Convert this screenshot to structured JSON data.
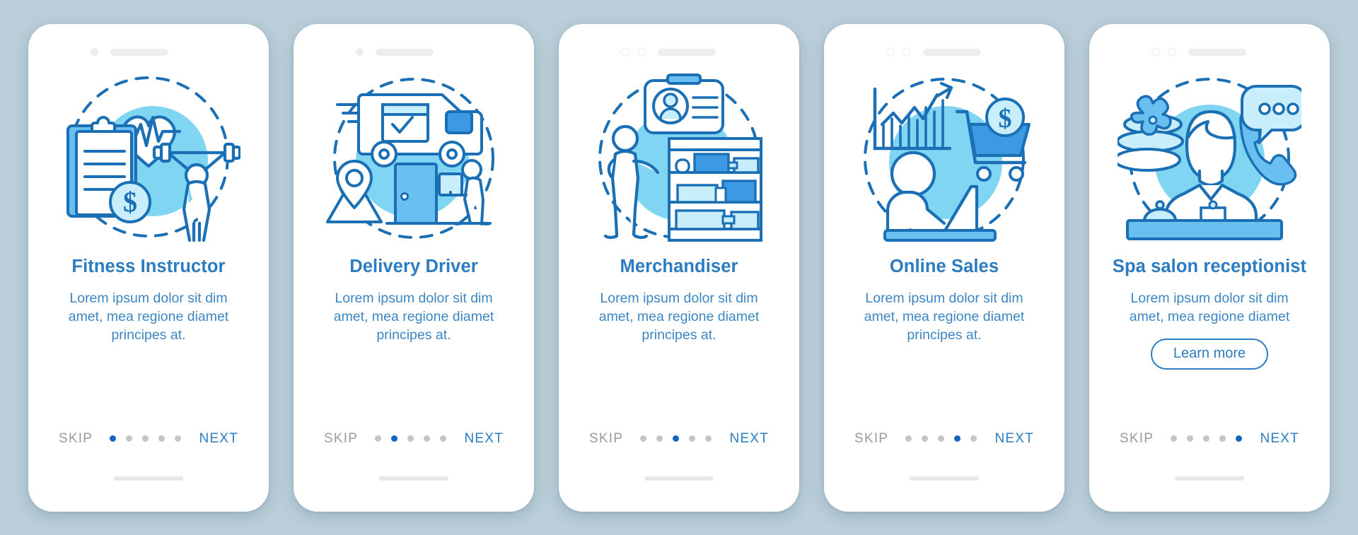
{
  "background_color": "#bacfda",
  "theme": {
    "title_color": "#2b7cc0",
    "body_color": "#3d86c3",
    "skip_color": "#9a9a9f",
    "next_color": "#2b7cc0",
    "active_dot_color": "#1464c0",
    "inactive_dot_color": "#c4c4c9",
    "line_color": "#1a6fb5",
    "disc_color": "#7fd5f2",
    "fill_light": "#c8eefb",
    "fill_mid": "#69c0f0",
    "fill_strong": "#3d9ae2",
    "card_background": "#ffffff"
  },
  "common": {
    "skip_label": "SKIP",
    "next_label": "NEXT",
    "dot_count": 5,
    "body_text": "Lorem ipsum dolor sit dim amet, mea regione diamet principes at."
  },
  "screens": [
    {
      "title": "Fitness Instructor",
      "body": "Lorem ipsum dolor sit dim amet, mea regione diamet principes at.",
      "skip_label": "SKIP",
      "next_label": "NEXT",
      "active_dot": 1,
      "notch_style": "single-camera",
      "illustration": "fitness-instructor-illustration",
      "illustration_elements": "heart-with-pulse, clipboard, dollar-coin, weightlifter, dashed-circle",
      "has_learn_more": false
    },
    {
      "title": "Delivery Driver",
      "body": "Lorem ipsum dolor sit dim amet, mea regione diamet principes at.",
      "skip_label": "SKIP",
      "next_label": "NEXT",
      "active_dot": 2,
      "notch_style": "single-camera",
      "illustration": "delivery-driver-illustration",
      "illustration_elements": "delivery-van, map-pin, door, courier-with-parcel, dashed-circle",
      "has_learn_more": false
    },
    {
      "title": "Merchandiser",
      "body": "Lorem ipsum dolor sit dim amet, mea regione diamet principes at.",
      "skip_label": "SKIP",
      "next_label": "NEXT",
      "active_dot": 3,
      "notch_style": "dual-camera",
      "illustration": "merchandiser-illustration",
      "illustration_elements": "id-badge, standing-person, product-shelf, dashed-circle",
      "has_learn_more": false
    },
    {
      "title": "Online Sales",
      "body": "Lorem ipsum dolor sit dim amet, mea regione diamet principes at.",
      "skip_label": "SKIP",
      "next_label": "NEXT",
      "active_dot": 4,
      "notch_style": "dual-camera",
      "illustration": "online-sales-illustration",
      "illustration_elements": "growth-chart, shopping-cart, dollar-coin, person-at-laptop, dashed-circle",
      "has_learn_more": false
    },
    {
      "title": "Spa salon receptionist",
      "body": "Lorem ipsum dolor sit dim amet, mea regione diamet",
      "skip_label": "SKIP",
      "next_label": "NEXT",
      "active_dot": 5,
      "notch_style": "dual-camera",
      "illustration": "spa-receptionist-illustration",
      "illustration_elements": "zen-stones-with-flower, receptionist, phone-handset, speech-bubble, reception-desk-with-bell, dashed-circle",
      "has_learn_more": true,
      "learn_more_label": "Learn more"
    }
  ]
}
